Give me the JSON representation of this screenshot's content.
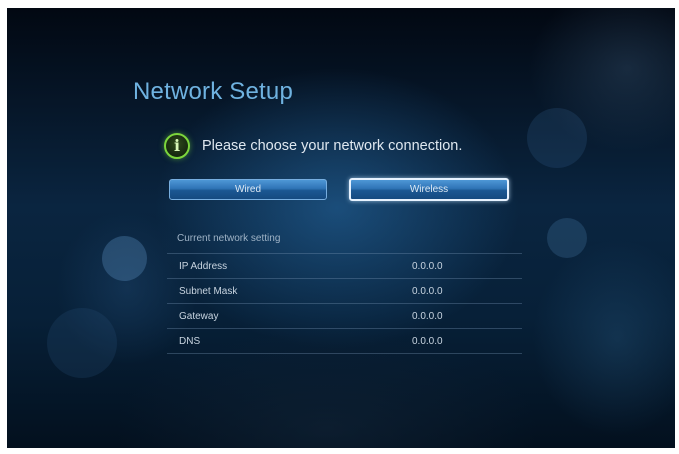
{
  "title": "Network Setup",
  "prompt": "Please choose your network connection.",
  "info_icon": "info-icon",
  "buttons": {
    "wired": "Wired",
    "wireless": "Wireless"
  },
  "selected_button": "wireless",
  "settings": {
    "heading": "Current network setting",
    "rows": [
      {
        "label": "IP Address",
        "value": "0.0.0.0"
      },
      {
        "label": "Subnet Mask",
        "value": "0.0.0.0"
      },
      {
        "label": "Gateway",
        "value": "0.0.0.0"
      },
      {
        "label": "DNS",
        "value": "0.0.0.0"
      }
    ]
  },
  "colors": {
    "title": "#6fb2e0",
    "button": "#2f74b6",
    "icon_ring": "#7cd63c"
  }
}
